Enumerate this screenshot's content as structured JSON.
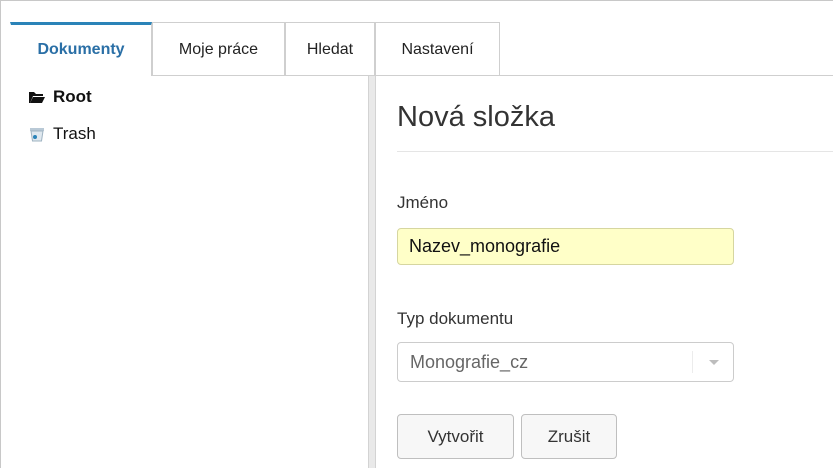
{
  "tabs": [
    {
      "label": "Dokumenty",
      "active": true
    },
    {
      "label": "Moje práce",
      "active": false
    },
    {
      "label": "Hledat",
      "active": false
    },
    {
      "label": "Nastavení",
      "active": false
    }
  ],
  "tree": {
    "root_label": "Root",
    "trash_label": "Trash",
    "root_icon": "folder-open-icon",
    "trash_icon": "trash-icon"
  },
  "form": {
    "title": "Nová složka",
    "name_label": "Jméno",
    "name_value": "Nazev_monografie",
    "type_label": "Typ dokumentu",
    "type_value": "Monografie_cz",
    "create_label": "Vytvořit",
    "cancel_label": "Zrušit"
  },
  "colors": {
    "accent": "#2a83b8",
    "input_highlight": "#ffffc8"
  }
}
